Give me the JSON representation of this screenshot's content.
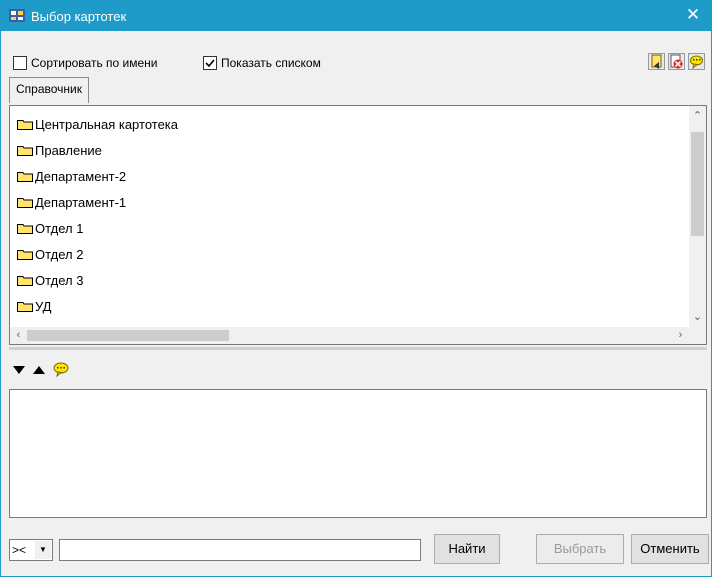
{
  "window": {
    "title": "Выбор картотек",
    "close_symbol": "✕",
    "accent_color": "#1e9bc9"
  },
  "options": {
    "sort_by_name": {
      "label": "Сортировать по имени",
      "checked": false
    },
    "show_as_list": {
      "label": "Показать списком",
      "checked": true
    }
  },
  "toolbar": {
    "icons": [
      "select-card-icon",
      "delete-card-icon",
      "comment-icon"
    ]
  },
  "tab": {
    "label": "Справочник"
  },
  "tree": {
    "items": [
      {
        "label": "Центральная картотека"
      },
      {
        "label": "Правление"
      },
      {
        "label": "Департамент-2"
      },
      {
        "label": "Департамент-1"
      },
      {
        "label": "Отдел 1"
      },
      {
        "label": "Отдел 2"
      },
      {
        "label": "Отдел 3"
      },
      {
        "label": "УД"
      }
    ]
  },
  "search": {
    "operator": "><",
    "query": ""
  },
  "buttons": {
    "find": "Найти",
    "select": "Выбрать",
    "cancel": "Отменить"
  }
}
